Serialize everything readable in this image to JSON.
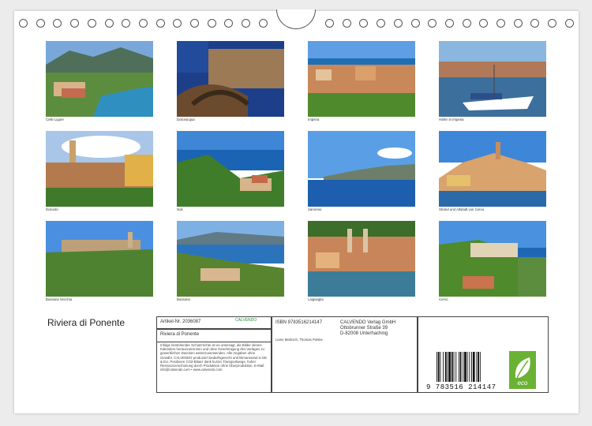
{
  "photos": [
    {
      "caption": "Celle Ligure"
    },
    {
      "caption": "Dolceacqua"
    },
    {
      "caption": "Imperia"
    },
    {
      "caption": "Hafen in Imperia"
    },
    {
      "caption": "Dolcedo"
    },
    {
      "caption": "Noli"
    },
    {
      "caption": "Sanremo"
    },
    {
      "caption": "Strand und Altstadt von Cervo"
    },
    {
      "caption": "Bussana Vecchia"
    },
    {
      "caption": "Bussana"
    },
    {
      "caption": "Laigueglia"
    },
    {
      "caption": "Cervo"
    }
  ],
  "title": "Riviera di Ponente",
  "info": {
    "article": "Artikel-Nr. 2036087",
    "calvendo_logo": "CALVENDO",
    "calendar_title": "Riviera di Ponente",
    "disclaimer": "Infolge bestehender Schutzrechte ist es untersagt, die Bilder dieses Kalenders herauszutrennen und ohne Genehmigung des Verlages zu gewerblichen Zwecken weiterzuverwenden. Alle Angaben ohne Gewähr. CALVENDO produziert bedarfsgerecht und klimaneutral in DE & EU. Positivere CO2-Bilanz dank kurzer Transportwege, hoher Ressourcenschonung durch Produktion ohne Überproduktion. E-Mail: info@calvendo.com • www.calvendo.com",
    "isbn": "ISBN 9783516214147",
    "author": "Liane Matrisch, Thomas Polske",
    "publisher": "CALVENDO Verlag GmbH",
    "street": "Ottobrunner Straße 39",
    "city": "D-82008 Unterhaching",
    "barcode_number": "9 783516 214147",
    "eco_label": "eco"
  },
  "colors": {
    "sky": "#4a8fd6",
    "sea": "#2a6fb3",
    "green": "#4c7a2e",
    "eco_green": "#6bb234"
  }
}
